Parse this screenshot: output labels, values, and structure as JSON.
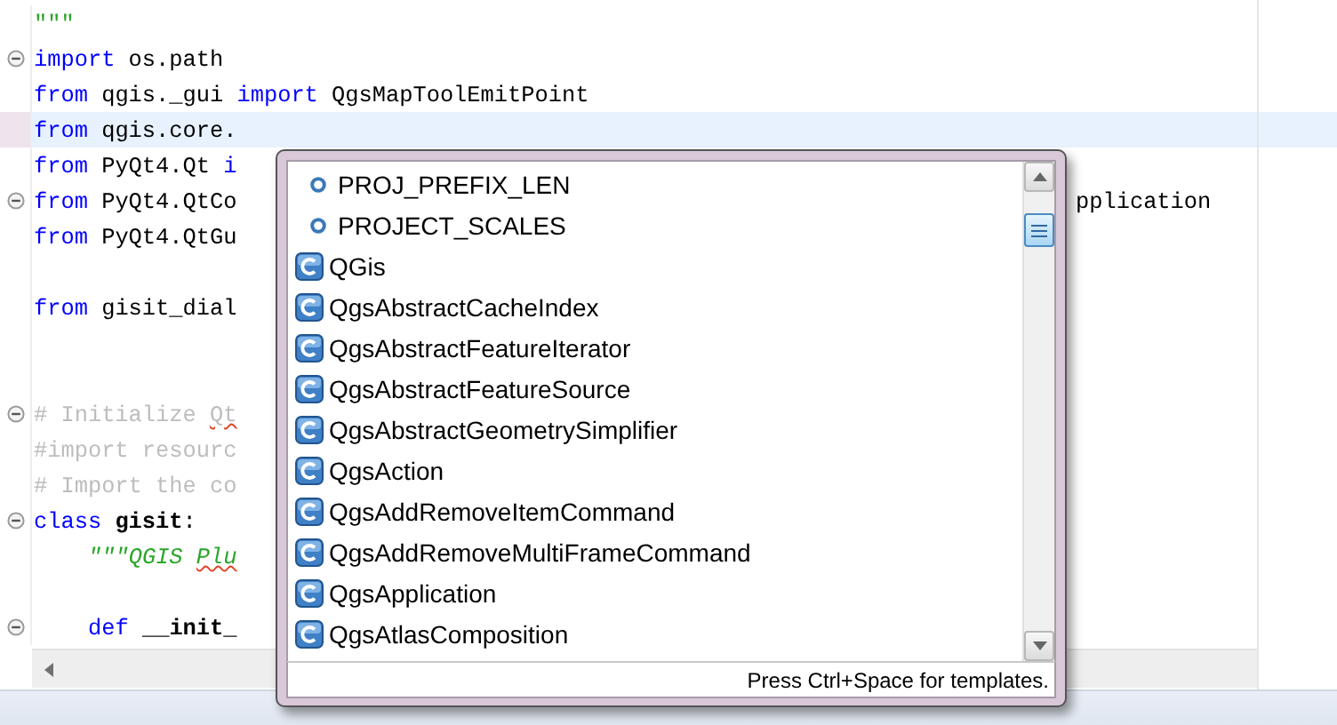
{
  "editor": {
    "lines": [
      {
        "fold": false,
        "current": false,
        "segments": [
          {
            "kind": "string",
            "text": "\"\"\""
          }
        ]
      },
      {
        "fold": true,
        "current": false,
        "segments": [
          {
            "kind": "keyword",
            "text": "import"
          },
          {
            "kind": "plain",
            "text": " os.path"
          }
        ]
      },
      {
        "fold": false,
        "current": false,
        "segments": [
          {
            "kind": "keyword",
            "text": "from"
          },
          {
            "kind": "plain",
            "text": " qgis._gui "
          },
          {
            "kind": "keyword",
            "text": "import"
          },
          {
            "kind": "plain",
            "text": " QgsMapToolEmitPoint"
          }
        ]
      },
      {
        "fold": false,
        "current": true,
        "segments": [
          {
            "kind": "keyword",
            "text": "from"
          },
          {
            "kind": "plain",
            "text": " qgis.core."
          }
        ]
      },
      {
        "fold": false,
        "current": false,
        "segments": [
          {
            "kind": "keyword",
            "text": "from"
          },
          {
            "kind": "plain",
            "text": " PyQt4.Qt "
          },
          {
            "kind": "keyword",
            "text": "i"
          }
        ]
      },
      {
        "fold": true,
        "current": false,
        "segments": [
          {
            "kind": "keyword",
            "text": "from"
          },
          {
            "kind": "plain",
            "text": " PyQt4.QtCo"
          }
        ]
      },
      {
        "fold": false,
        "current": false,
        "segments": [
          {
            "kind": "keyword",
            "text": "from"
          },
          {
            "kind": "plain",
            "text": " PyQt4.QtGu"
          }
        ]
      },
      {
        "fold": false,
        "current": false
      },
      {
        "fold": false,
        "current": false,
        "segments": [
          {
            "kind": "keyword",
            "text": "from"
          },
          {
            "kind": "plain",
            "text": " gisit_dial"
          }
        ]
      },
      {
        "fold": false,
        "current": false
      },
      {
        "fold": false,
        "current": false
      },
      {
        "fold": true,
        "current": false,
        "segments": [
          {
            "kind": "comment",
            "text": "# Initialize "
          },
          {
            "kind": "comment",
            "text": "Qt",
            "spell": true
          }
        ]
      },
      {
        "fold": false,
        "current": false,
        "segments": [
          {
            "kind": "comment",
            "text": "#import resourc"
          }
        ]
      },
      {
        "fold": false,
        "current": false,
        "segments": [
          {
            "kind": "comment",
            "text": "# Import the co"
          }
        ]
      },
      {
        "fold": true,
        "current": false,
        "segments": [
          {
            "kind": "keyword",
            "text": "class "
          },
          {
            "kind": "bold",
            "text": "gisit"
          },
          {
            "kind": "plain",
            "text": ":"
          }
        ]
      },
      {
        "fold": false,
        "current": false,
        "indent": true,
        "segments": [
          {
            "kind": "string",
            "text": "\"\"\"QGIS "
          },
          {
            "kind": "string",
            "text": "Plu",
            "spell": true
          }
        ]
      },
      {
        "fold": false,
        "current": false
      },
      {
        "fold": true,
        "current": false,
        "indent": true,
        "segments": [
          {
            "kind": "keyword",
            "text": "def "
          },
          {
            "kind": "bold",
            "text": "__init_"
          }
        ]
      }
    ],
    "right_text": "pplication"
  },
  "completion": {
    "items": [
      {
        "kind": "constant",
        "label": "PROJ_PREFIX_LEN"
      },
      {
        "kind": "constant",
        "label": "PROJECT_SCALES"
      },
      {
        "kind": "class",
        "label": "QGis"
      },
      {
        "kind": "class",
        "label": "QgsAbstractCacheIndex"
      },
      {
        "kind": "class",
        "label": "QgsAbstractFeatureIterator"
      },
      {
        "kind": "class",
        "label": "QgsAbstractFeatureSource"
      },
      {
        "kind": "class",
        "label": "QgsAbstractGeometrySimplifier"
      },
      {
        "kind": "class",
        "label": "QgsAction"
      },
      {
        "kind": "class",
        "label": "QgsAddRemoveItemCommand"
      },
      {
        "kind": "class",
        "label": "QgsAddRemoveMultiFrameCommand"
      },
      {
        "kind": "class",
        "label": "QgsApplication"
      },
      {
        "kind": "class",
        "label": "QgsAtlasComposition"
      }
    ],
    "footer": "Press Ctrl+Space for templates."
  }
}
